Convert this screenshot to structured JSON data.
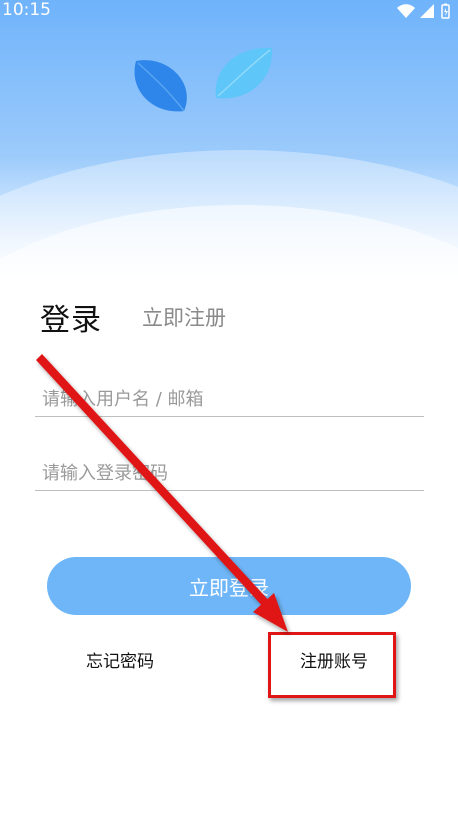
{
  "status_bar": {
    "time": "10:15",
    "icons": [
      "wifi-icon",
      "signal-icon",
      "battery-icon"
    ]
  },
  "header": {
    "decor_icons": [
      "leaf-dark-icon",
      "leaf-light-icon"
    ]
  },
  "tabs": {
    "login_label": "登录",
    "register_label": "立即注册"
  },
  "form": {
    "username_placeholder": "请输入用户名 / 邮箱",
    "username_value": "",
    "password_placeholder": "请输入登录密码",
    "password_value": ""
  },
  "actions": {
    "login_button": "立即登录",
    "forgot_password": "忘记密码",
    "register_account": "注册账号"
  },
  "annotation": {
    "arrow_color": "#e01515",
    "box_color": "#e01515"
  },
  "colors": {
    "primary": "#6fb6f8",
    "header_top": "#6fb3fb"
  }
}
